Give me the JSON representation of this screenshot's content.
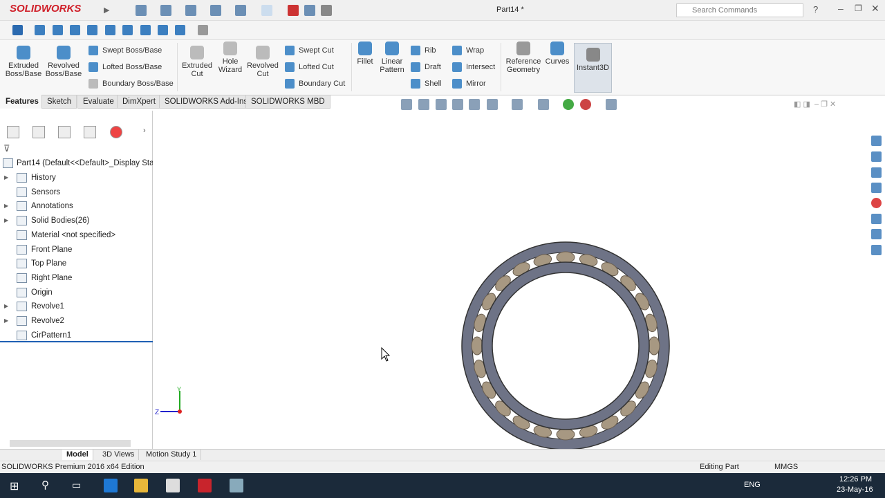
{
  "app": {
    "logo": "SOLIDWORKS",
    "doc_title": "Part14 *",
    "search_placeholder": "Search Commands",
    "help": "?"
  },
  "ribbon": {
    "extruded_boss": "Extruded Boss/Base",
    "revolved_boss": "Revolved Boss/Base",
    "swept_boss": "Swept Boss/Base",
    "lofted_boss": "Lofted Boss/Base",
    "boundary_boss": "Boundary Boss/Base",
    "extruded_cut": "Extruded Cut",
    "hole_wizard": "Hole Wizard",
    "revolved_cut": "Revolved Cut",
    "swept_cut": "Swept Cut",
    "lofted_cut": "Lofted Cut",
    "boundary_cut": "Boundary Cut",
    "fillet": "Fillet",
    "linear_pattern": "Linear Pattern",
    "rib": "Rib",
    "draft": "Draft",
    "shell": "Shell",
    "wrap": "Wrap",
    "intersect": "Intersect",
    "mirror": "Mirror",
    "reference_geometry": "Reference Geometry",
    "curves": "Curves",
    "instant3d": "Instant3D"
  },
  "tabs": [
    "Features",
    "Sketch",
    "Evaluate",
    "DimXpert",
    "SOLIDWORKS Add-Ins",
    "SOLIDWORKS MBD"
  ],
  "tree": {
    "root": "Part14  (Default<<Default>_Display Stat",
    "items": [
      {
        "label": "History",
        "expandable": true
      },
      {
        "label": "Sensors",
        "expandable": false
      },
      {
        "label": "Annotations",
        "expandable": true
      },
      {
        "label": "Solid Bodies(26)",
        "expandable": true
      },
      {
        "label": "Material <not specified>",
        "expandable": false
      },
      {
        "label": "Front Plane",
        "expandable": false
      },
      {
        "label": "Top Plane",
        "expandable": false
      },
      {
        "label": "Right Plane",
        "expandable": false
      },
      {
        "label": "Origin",
        "expandable": false
      },
      {
        "label": "Revolve1",
        "expandable": true
      },
      {
        "label": "Revolve2",
        "expandable": true
      },
      {
        "label": "CirPattern1",
        "expandable": false
      }
    ]
  },
  "bottom_tabs": [
    "Model",
    "3D Views",
    "Motion Study 1"
  ],
  "status": {
    "edition": "SOLIDWORKS Premium 2016 x64 Edition",
    "mode": "Editing Part",
    "units": "MMGS"
  },
  "axis": {
    "z": "Z",
    "y": "Y"
  },
  "model": {
    "roller_count": 24,
    "race_color": "#6e7386",
    "roller_color": "#a79882"
  },
  "taskbar": {
    "lang": "ENG",
    "time": "12:26 PM",
    "date": "23-May-16"
  }
}
